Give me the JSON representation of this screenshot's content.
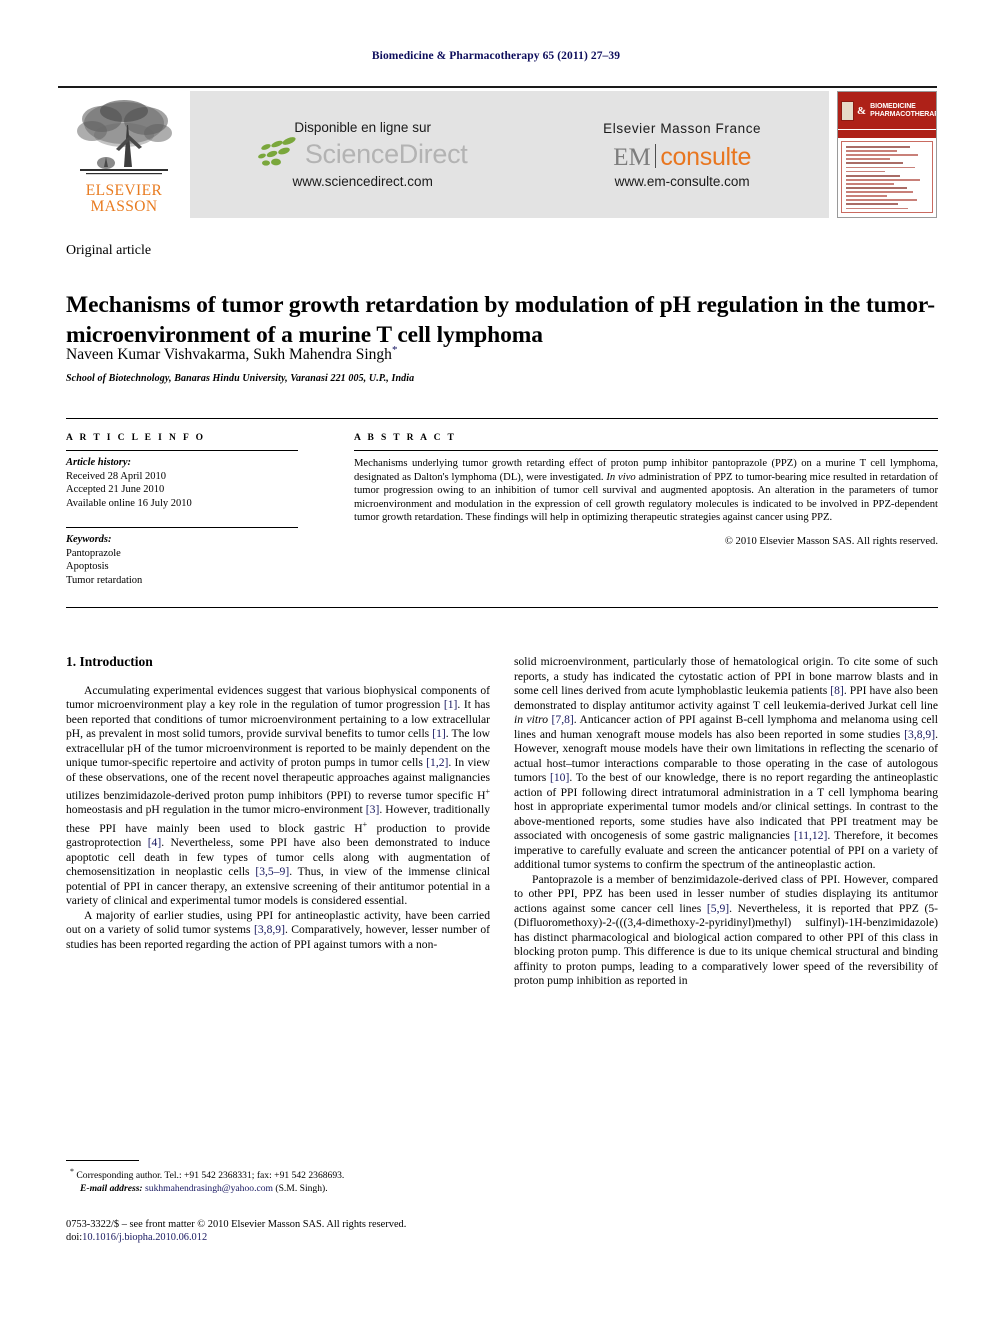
{
  "running_head": "Biomedicine & Pharmacotherapy 65 (2011) 27–39",
  "banner": {
    "publisher_logo": {
      "line1": "ELSEVIER",
      "line2": "MASSON",
      "icon": "elsevier-tree-logo",
      "color": "#e87b20"
    },
    "sciencedirect": {
      "caption": "Disponible en ligne sur",
      "wordmark": "ScienceDirect",
      "url": "www.sciencedirect.com",
      "leaf_color": "#7aa73c",
      "wordmark_color": "#b3b3b3"
    },
    "emconsulte": {
      "caption": "Elsevier Masson France",
      "wordmark_left": "EM",
      "wordmark_right": "consulte",
      "url": "www.em-consulte.com",
      "accent_color": "#e8761f"
    },
    "cover": {
      "title_line1": "BIOMEDICINE",
      "title_line2": "PHARMACOTHERAPY",
      "ampersand": "&",
      "header_color": "#ae2118"
    }
  },
  "article": {
    "type": "Original article",
    "title": "Mechanisms of tumor growth retardation by modulation of pH regulation in the tumor-microenvironment of a murine T cell lymphoma",
    "authors": "Naveen Kumar Vishvakarma, Sukh Mahendra Singh",
    "author_marker": "*",
    "affiliation": "School of Biotechnology, Banaras Hindu University, Varanasi 221 005, U.P., India"
  },
  "article_info": {
    "heading": "A R T I C L E   I N F O",
    "history_label": "Article history:",
    "history": [
      "Received 28 April 2010",
      "Accepted 21 June 2010",
      "Available online 16 July 2010"
    ],
    "keywords_label": "Keywords:",
    "keywords": [
      "Pantoprazole",
      "Apoptosis",
      "Tumor retardation"
    ]
  },
  "abstract": {
    "heading": "A B S T R A C T",
    "p1_a": "Mechanisms underlying tumor growth retarding effect of proton pump inhibitor pantoprazole (PPZ) on a murine T cell lymphoma, designated as Dalton's lymphoma (DL), were investigated. ",
    "p1_italic": "In vivo",
    "p1_b": " administration of PPZ to tumor-bearing mice resulted in retardation of tumor progression owing to an inhibition of tumor cell survival and augmented apoptosis. An alteration in the parameters of tumor microenvironment and modulation in the expression of cell growth regulatory molecules is indicated to be involved in PPZ-dependent tumor growth retardation. These findings will help in optimizing therapeutic strategies against cancer using PPZ.",
    "copyright": "© 2010 Elsevier Masson SAS. All rights reserved."
  },
  "body": {
    "section_heading": "1. Introduction",
    "left": {
      "p1_a": "Accumulating experimental evidences suggest that various biophysical components of tumor microenvironment play a key role in the regulation of tumor progression ",
      "p1_r1": "[1]",
      "p1_b": ". It has been reported that conditions of tumor microenvironment pertaining to a low extracellular pH, as prevalent in most solid tumors, provide survival benefits to tumor cells ",
      "p1_r2": "[1]",
      "p1_c": ". The low extracellular pH of the tumor microenvironment is reported to be mainly dependent on the unique tumor-specific repertoire and activity of proton pumps in tumor cells ",
      "p1_r3": "[1,2]",
      "p1_d": ". In view of these observations, one of the recent novel therapeutic approaches against malignancies utilizes benzimidazole-derived proton pump inhibitors (PPI) to reverse tumor specific H",
      "p1_sup1": "+",
      "p1_e": " homeostasis and pH regulation in the tumor micro-environment ",
      "p1_r4": "[3]",
      "p1_f": ". However, traditionally these PPI have mainly been used to block gastric H",
      "p1_sup2": "+",
      "p1_g": " production to provide gastroprotection ",
      "p1_r5": "[4]",
      "p1_h": ". Nevertheless, some PPI have also been demonstrated to induce apoptotic cell death in few types of tumor cells along with augmentation of chemosensitization in neoplastic cells ",
      "p1_r6": "[3,5–9]",
      "p1_i": ". Thus, in view of the immense clinical potential of PPI in cancer therapy, an extensive screening of their antitumor potential in a variety of clinical and experimental tumor models is considered essential.",
      "p2_a": "A majority of earlier studies, using PPI for antineoplastic activity, have been carried out on a variety of solid tumor systems ",
      "p2_r1": "[3,8,9]",
      "p2_b": ". Comparatively, however, lesser number of studies has been reported regarding the action of PPI against tumors with a non-"
    },
    "right": {
      "p1_a": "solid microenvironment, particularly those of hematological origin. To cite some of such reports, a study has indicated the cytostatic action of PPI in bone marrow blasts and in some cell lines derived from acute lymphoblastic leukemia patients ",
      "p1_r1": "[8]",
      "p1_b": ". PPI have also been demonstrated to display antitumor activity against T cell leukemia-derived Jurkat cell line ",
      "p1_italic": "in vitro",
      "p1_c": " ",
      "p1_r2": "[7,8]",
      "p1_d": ". Anticancer action of PPI against B-cell lymphoma and melanoma using cell lines and human xenograft mouse models has also been reported in some studies ",
      "p1_r3": "[3,8,9]",
      "p1_e": ". However, xenograft mouse models have their own limitations in reflecting the scenario of actual host–tumor interactions comparable to those operating in the case of autologous tumors ",
      "p1_r4": "[10]",
      "p1_f": ". To the best of our knowledge, there is no report regarding the antineoplastic action of PPI following direct intratumoral administration in a T cell lymphoma bearing host in appropriate experimental tumor models and/or clinical settings. In contrast to the above-mentioned reports, some studies have also indicated that PPI treatment may be associated with oncogenesis of some gastric malignancies ",
      "p1_r5": "[11,12]",
      "p1_g": ". Therefore, it becomes imperative to carefully evaluate and screen the anticancer potential of PPI on a variety of additional tumor systems to confirm the spectrum of the antineoplastic action.",
      "p2_a": "Pantoprazole is a member of benzimidazole-derived class of PPI. However, compared to other PPI, PPZ has been used in lesser number of studies displaying its antitumor actions against some cancer cell lines ",
      "p2_r1": "[5,9]",
      "p2_b": ". Nevertheless, it is reported that PPZ (5-(Difluoromethoxy)-2-(((3,4-dimethoxy-2-pyridinyl)methyl) sulfinyl)-1H-benzimidazole) has distinct pharmacological and biological action compared to other PPI of this class in blocking proton pump. This difference is due to its unique chemical structural and binding affinity to proton pumps, leading to a comparatively lower speed of the reversibility of proton pump inhibition as reported in"
    }
  },
  "footnote": {
    "marker": "*",
    "line1": "Corresponding author. Tel.: +91 542 2368331; fax: +91 542 2368693.",
    "email_label": "E-mail address:",
    "email": "sukhmahendrasingh@yahoo.com",
    "email_suffix": " (S.M. Singh)."
  },
  "footer": {
    "line1": "0753-3322/$ – see front matter © 2010 Elsevier Masson SAS. All rights reserved.",
    "doi_label": "doi:",
    "doi": "10.1016/j.biopha.2010.06.012"
  }
}
